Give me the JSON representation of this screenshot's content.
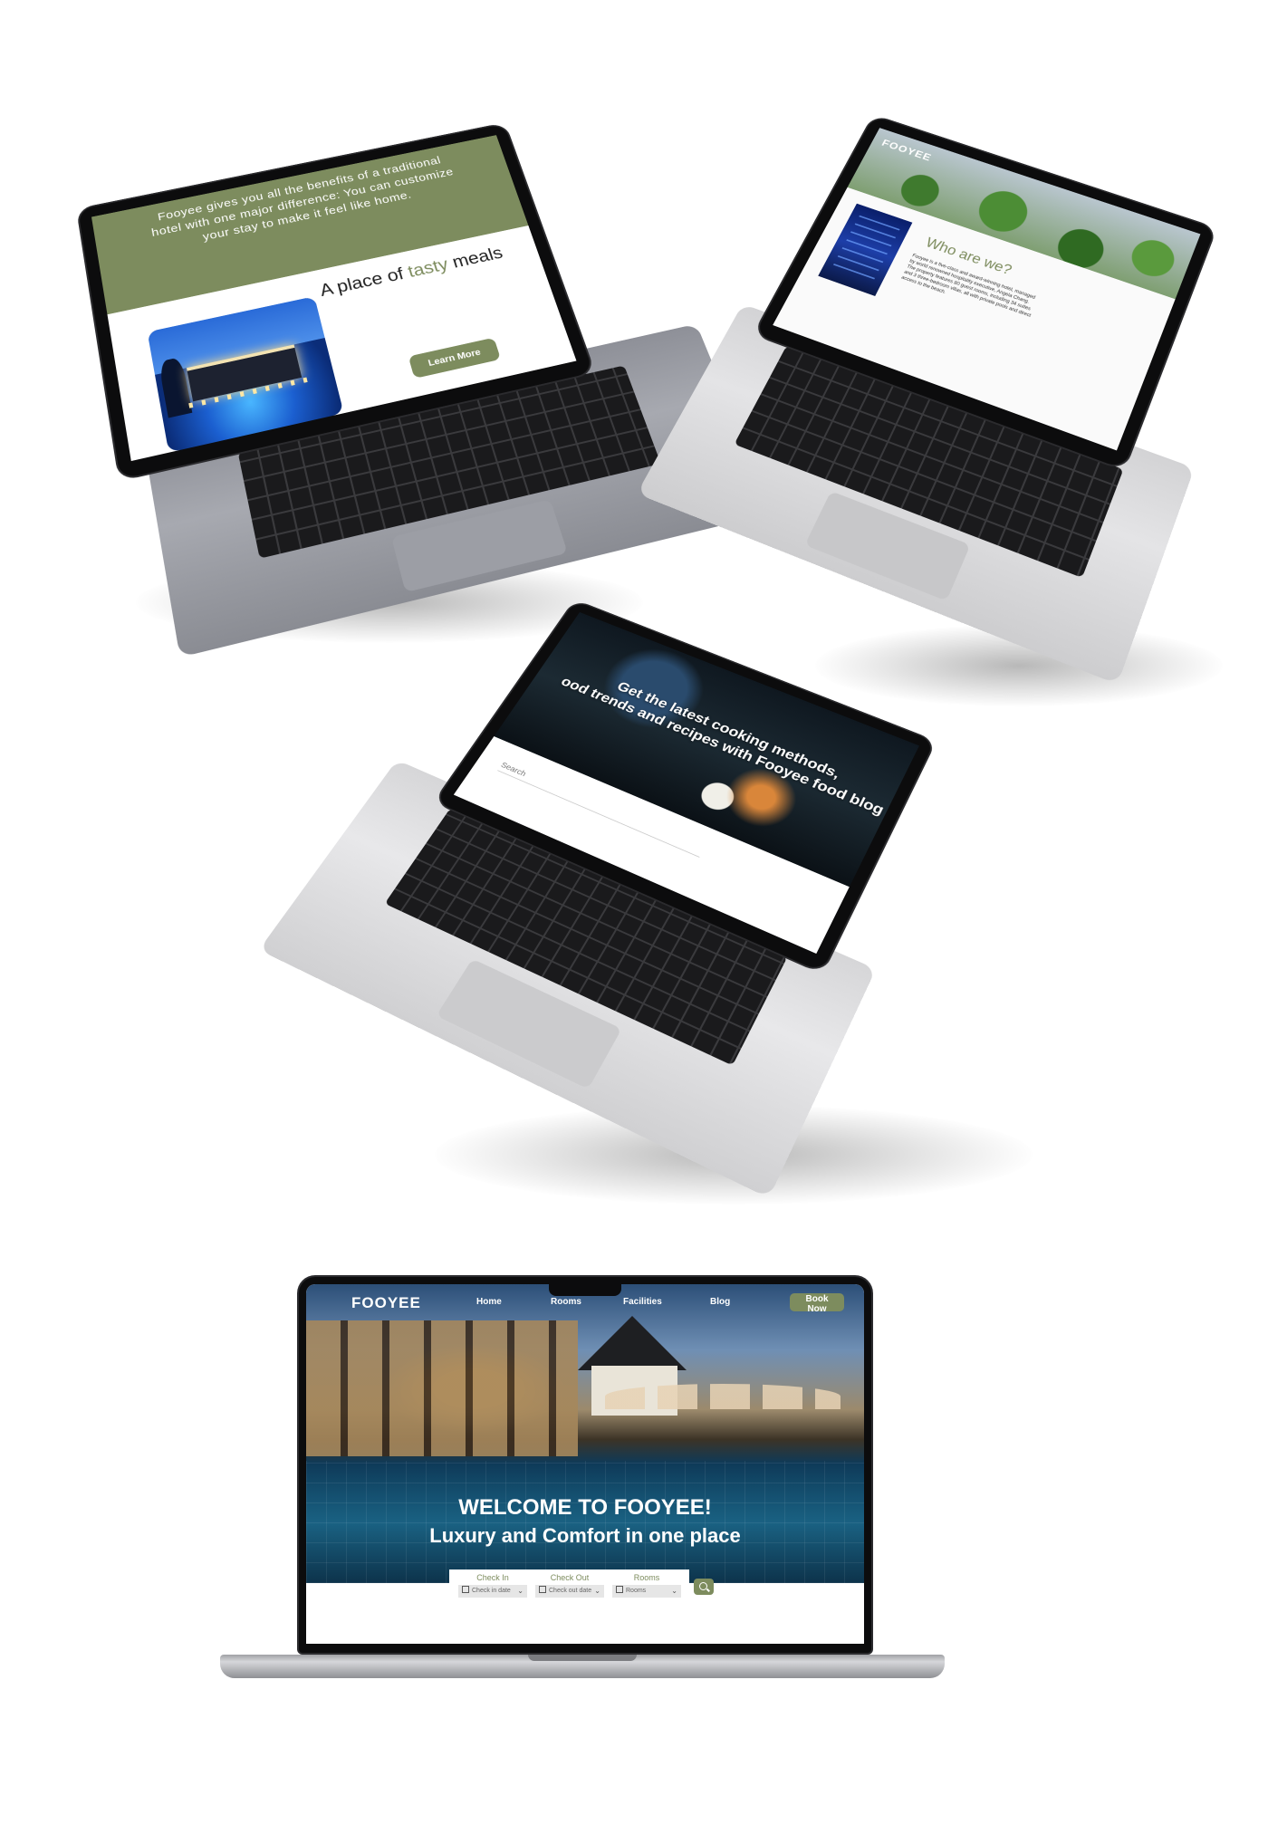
{
  "mockup1": {
    "intro_line1": "Fooyee gives you all the benefits of a traditional",
    "intro_line2": "hotel with one major difference: You can customize",
    "intro_line3": "your stay to make it feel like home.",
    "heading_pre": "A place of ",
    "heading_accent": "tasty",
    "heading_post": " meals",
    "learn_more": "Learn More"
  },
  "mockup2": {
    "brand": "FOOYEE",
    "title": "Who are we?",
    "body": "Fooyee is a five-class and award-winning hotel, managed by world renowned hospitality executive, Angela Chang. The property features 80 guest rooms, including 34 suites and 3 three-bedroom villas, all with private pools and direct access to the beach."
  },
  "mockup3": {
    "headline_line1": "Get the latest cooking methods,",
    "headline_line2": "ood trends and recipes with Fooyee food blog",
    "search_placeholder": "Search"
  },
  "mockup4": {
    "logo": "FOOYEE",
    "nav": [
      "Home",
      "Rooms",
      "Facilities",
      "Blog"
    ],
    "book_now": "Book Now",
    "title_line1": "WELCOME TO FOOYEE!",
    "title_line2": "Luxury and Comfort in one place",
    "booking": [
      {
        "label": "Check In",
        "placeholder": "Check in date"
      },
      {
        "label": "Check Out",
        "placeholder": "Check out date"
      },
      {
        "label": "Rooms",
        "placeholder": "Rooms"
      }
    ]
  },
  "colors": {
    "accent_green": "#7d8c5e",
    "white": "#ffffff"
  },
  "icons": [
    "calendar-icon",
    "chevron-down-icon",
    "search-icon"
  ]
}
